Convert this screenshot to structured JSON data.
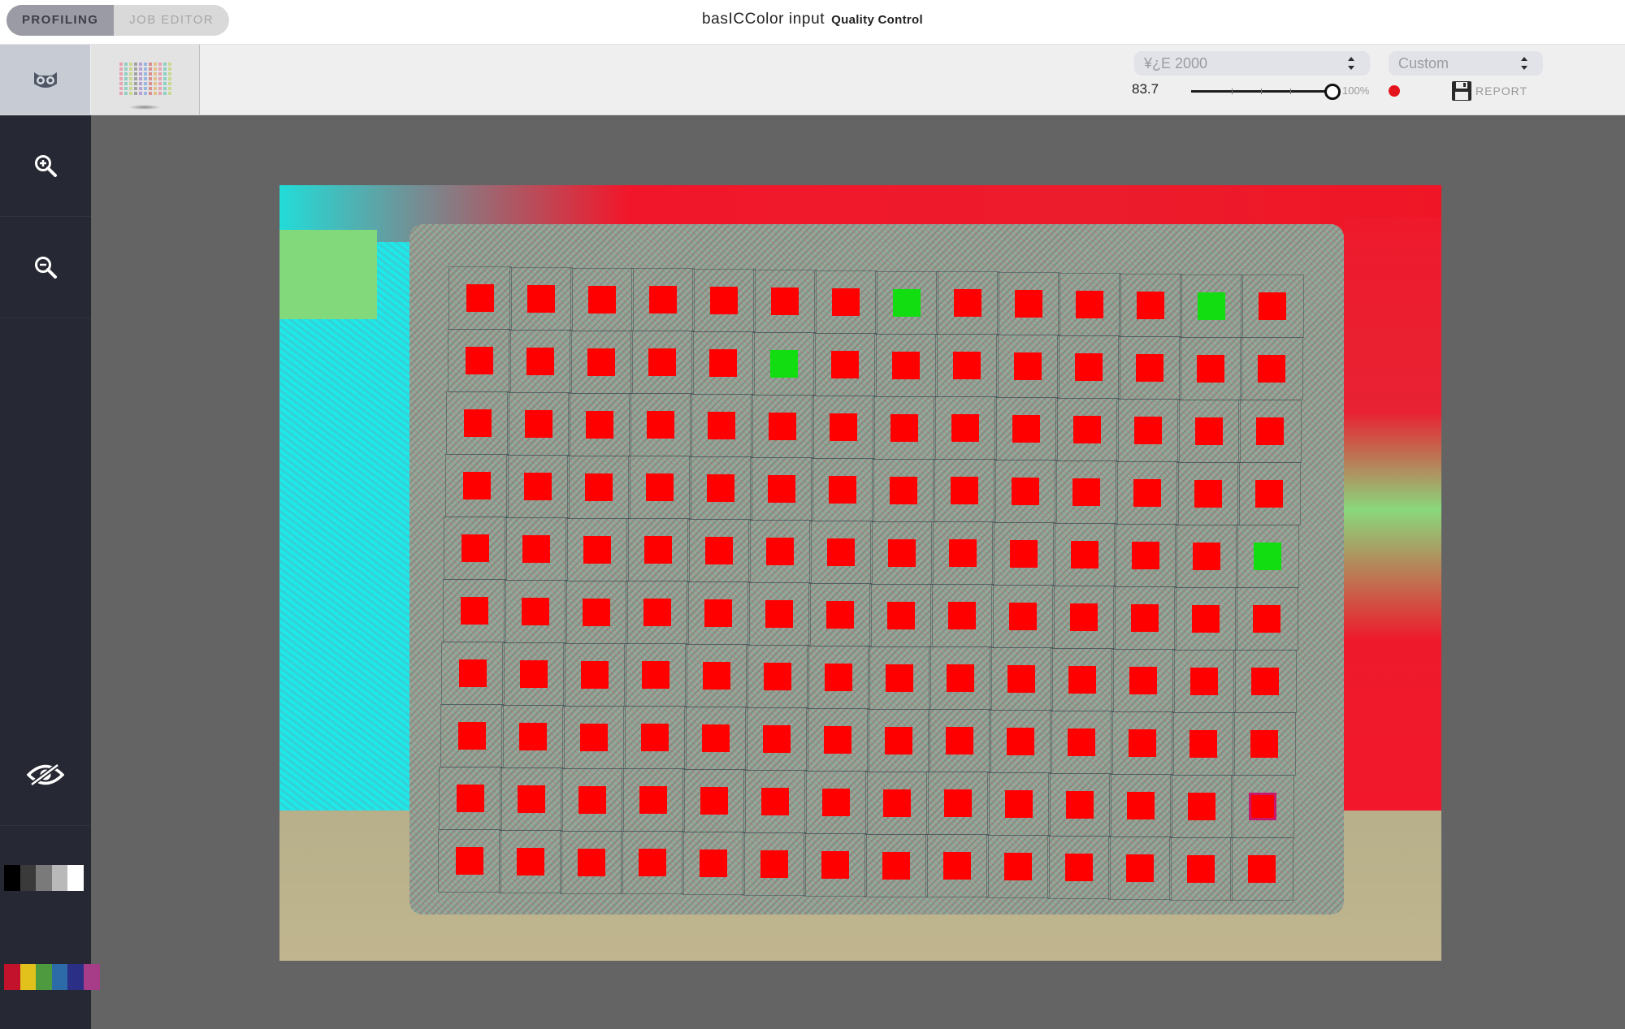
{
  "titlebar": {
    "tabs": [
      {
        "label": "PROFILING",
        "active": true
      },
      {
        "label": "JOB EDITOR",
        "active": false
      }
    ],
    "app_title": "basICColor input",
    "app_subtitle": "Quality Control"
  },
  "toolbar": {
    "mode_tabs": [
      {
        "icon": "owl-icon",
        "active": true
      },
      {
        "icon": "color-chart-icon",
        "active": false
      }
    ],
    "metric_select": "¥¿E 2000",
    "preset_select": "Custom",
    "tolerance_value": "83.7",
    "slider_percent_label": "100%",
    "slider_value_fraction": 1.0,
    "status_color": "#e5141c",
    "report_label": "REPORT"
  },
  "sidebar": {
    "items": [
      {
        "icon": "zoom-in-icon"
      },
      {
        "icon": "zoom-out-icon"
      },
      {
        "icon": "eye-icon"
      },
      {
        "icon": "grayscale-swatch-icon"
      },
      {
        "icon": "color-swatch-icon"
      }
    ],
    "gray_swatches": [
      "#000000",
      "#3a3a3a",
      "#7a7a7a",
      "#b9b9b9",
      "#ffffff"
    ],
    "color_swatches": [
      "#c3122b",
      "#e3c11d",
      "#4e9a3e",
      "#2d6aa8",
      "#2c2f86",
      "#a73c88"
    ]
  },
  "patch_grid": {
    "rows": 10,
    "cols": 14,
    "fail_color": "#ff0000",
    "pass_color": "#11dd11",
    "special_color": "#c8186c",
    "pass_cells": [
      [
        0,
        7
      ],
      [
        0,
        12
      ],
      [
        1,
        5
      ],
      [
        4,
        13
      ]
    ],
    "special_cells": [
      [
        8,
        13
      ]
    ]
  },
  "colors": {
    "sidebar_bg": "#262833",
    "canvas_bg": "#646464",
    "toolbar_bg": "#efefef"
  }
}
